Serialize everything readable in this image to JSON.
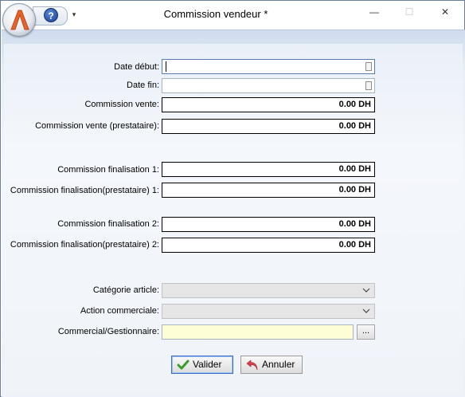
{
  "window": {
    "title": "Commission vendeur *",
    "help_label": "?",
    "qa_dropdown": "▾",
    "minimize": "—",
    "maximize": "☐",
    "close": "✕"
  },
  "form": {
    "date_debut_label": "Date début:",
    "date_debut_value": "",
    "date_fin_label": "Date fin:",
    "date_fin_value": "",
    "commission_vente_label": "Commission vente:",
    "commission_vente_value": "0.00 DH",
    "commission_vente_prest_label": "Commission vente (prestataire):",
    "commission_vente_prest_value": "0.00 DH",
    "commission_final1_label": "Commission finalisation 1:",
    "commission_final1_value": "0.00 DH",
    "commission_final1_prest_label": "Commission finalisation(prestataire) 1:",
    "commission_final1_prest_value": "0.00 DH",
    "commission_final2_label": "Commission finalisation 2:",
    "commission_final2_value": "0.00 DH",
    "commission_final2_prest_label": "Commission finalisation(prestataire) 2:",
    "commission_final2_prest_value": "0.00 DH",
    "categorie_label": "Catégorie article:",
    "categorie_value": "",
    "action_label": "Action commerciale:",
    "action_value": "",
    "commercial_label": "Commercial/Gestionnaire:",
    "commercial_value": "",
    "browse_label": "..."
  },
  "buttons": {
    "valider": "Valider",
    "annuler": "Annuler"
  },
  "colors": {
    "accent": "#3c6fc6",
    "highlight_field": "#fdfdd6",
    "brand_orange": "#e8632b"
  },
  "icons": {
    "logo": "app-logo-icon",
    "help": "help-icon",
    "valider": "check-icon",
    "annuler": "undo-icon"
  }
}
